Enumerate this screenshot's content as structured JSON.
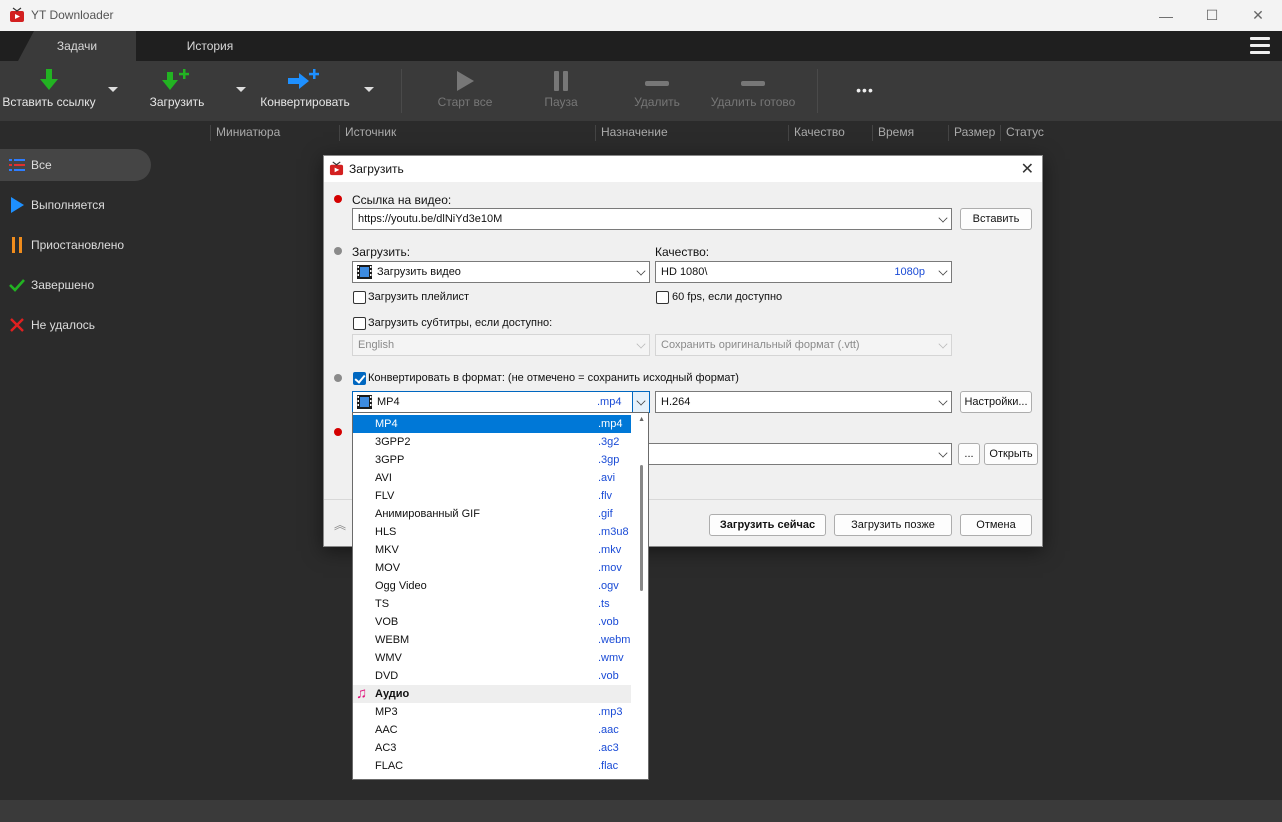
{
  "window": {
    "title": "YT Downloader",
    "minimize": "—",
    "maximize": "☐",
    "close": "✕"
  },
  "tabs": [
    {
      "label": "Задачи"
    },
    {
      "label": "История"
    }
  ],
  "toolbar": {
    "paste": "Вставить ссылку",
    "download": "Загрузить",
    "convert": "Конвертировать",
    "start_all": "Старт все",
    "pause": "Пауза",
    "delete": "Удалить",
    "delete_done": "Удалить готово",
    "more": "•••"
  },
  "columns": [
    "Миниатюра",
    "Источник",
    "Назначение",
    "Качество",
    "Время",
    "Размер",
    "Статус"
  ],
  "sidebar": [
    {
      "label": "Все"
    },
    {
      "label": "Выполняется"
    },
    {
      "label": "Приостановлено"
    },
    {
      "label": "Завершено"
    },
    {
      "label": "Не удалось"
    }
  ],
  "dialog": {
    "title": "Загрузить",
    "url_label": "Ссылка на видео:",
    "url_value": "https://youtu.be/dlNiYd3e10M",
    "paste_button": "Вставить",
    "download_label": "Загрузить:",
    "download_value": "Загрузить видео",
    "quality_label": "Качество:",
    "quality_value": "HD 1080\\",
    "quality_tag": "1080p",
    "playlist_check": "Загрузить плейлист",
    "fps_check": "60 fps, если доступно",
    "subtitles_check": "Загрузить субтитры, если доступно:",
    "subtitles_lang": "English",
    "subtitles_format": "Сохранить оригинальный формат (.vtt)",
    "convert_check": "Конвертировать в формат: (не отмечено = сохранить исходный формат)",
    "format_value": "MP4",
    "format_ext": ".mp4",
    "codec_value": "H.264",
    "settings_button": "Настройки...",
    "browse_button": "...",
    "open_button": "Открыть",
    "download_now": "Загрузить сейчас",
    "download_later": "Загрузить позже",
    "cancel": "Отмена",
    "collapse_icon": "︽"
  },
  "format_list": [
    {
      "name": "MP4",
      "ext": ".mp4",
      "selected": true
    },
    {
      "name": "3GPP2",
      "ext": ".3g2"
    },
    {
      "name": "3GPP",
      "ext": ".3gp"
    },
    {
      "name": "AVI",
      "ext": ".avi"
    },
    {
      "name": "FLV",
      "ext": ".flv"
    },
    {
      "name": "Анимированный GIF",
      "ext": ".gif"
    },
    {
      "name": "HLS",
      "ext": ".m3u8"
    },
    {
      "name": "MKV",
      "ext": ".mkv"
    },
    {
      "name": "MOV",
      "ext": ".mov"
    },
    {
      "name": "Ogg Video",
      "ext": ".ogv"
    },
    {
      "name": "TS",
      "ext": ".ts"
    },
    {
      "name": "VOB",
      "ext": ".vob"
    },
    {
      "name": "WEBM",
      "ext": ".webm"
    },
    {
      "name": "WMV",
      "ext": ".wmv"
    },
    {
      "name": "DVD",
      "ext": ".vob"
    },
    {
      "name": "Аудио",
      "ext": "",
      "group": true
    },
    {
      "name": "MP3",
      "ext": ".mp3"
    },
    {
      "name": "AAC",
      "ext": ".aac"
    },
    {
      "name": "AC3",
      "ext": ".ac3"
    },
    {
      "name": "FLAC",
      "ext": ".flac"
    }
  ],
  "colors": {
    "accent": "#0078d7",
    "required_dot": "#d40000",
    "optional_dot": "#8a8a8a",
    "green": "#22b322",
    "blue_icon": "#1e90ff",
    "orange": "#f08c1c",
    "red": "#e02020"
  }
}
